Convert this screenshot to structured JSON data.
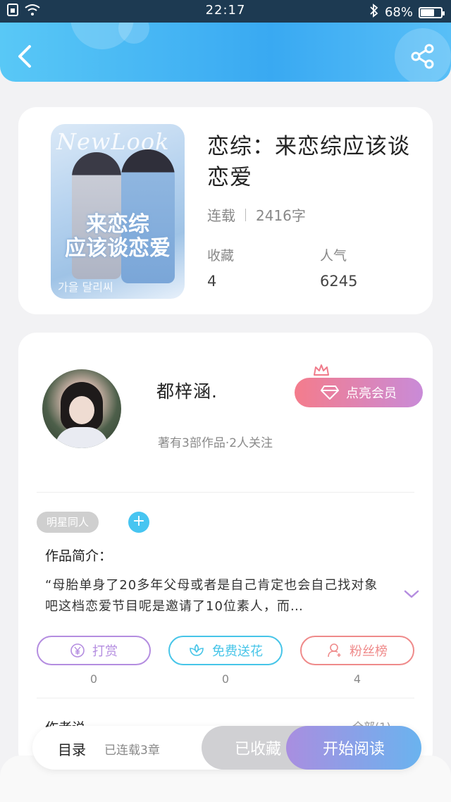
{
  "status_bar": {
    "time": "22:17",
    "battery_text": "68%",
    "battery_level": 0.68
  },
  "header": {
    "back_icon": "chevron-left-icon",
    "share_icon": "share-icon"
  },
  "book": {
    "title": "恋综：来恋综应该谈恋爱",
    "status": "连载",
    "word_count": "2416字",
    "favorites_label": "收藏",
    "favorites_value": "4",
    "popularity_label": "人气",
    "popularity_value": "6245",
    "cover": {
      "brand": "NewLook",
      "title_line1": "来恋综",
      "title_line2": "应该谈恋爱",
      "subtitle": "가을 달리씨"
    }
  },
  "author": {
    "name": "都梓涵.",
    "info": "著有3部作品·2人关注",
    "vip_button": "点亮会员"
  },
  "tags": [
    "明星同人"
  ],
  "intro": {
    "label": "作品简介：",
    "text": "“母胎单身了20多年父母或者是自己肯定也会自己找对象吧这档恋爱节目呢是邀请了10位素人，而…"
  },
  "actions": [
    {
      "label": "打赏",
      "count": "0",
      "icon": "yen-icon",
      "color": "#b48de0"
    },
    {
      "label": "免费送花",
      "count": "0",
      "icon": "flower-icon",
      "color": "#47c5e8"
    },
    {
      "label": "粉丝榜",
      "count": "4",
      "icon": "user-icon",
      "color": "#ef8a8a"
    }
  ],
  "author_says": {
    "label": "作者说",
    "link": "全部(1)"
  },
  "bottom_bar": {
    "toc": "目录",
    "toc_sub": "已连载3章",
    "collected": "已收藏",
    "start_reading": "开始阅读"
  },
  "colors": {
    "header_start": "#59c8f6",
    "header_end": "#39a9f2",
    "vip_start": "#f47c8c",
    "vip_end": "#c98bd8",
    "read_start": "#a98ee0",
    "read_end": "#6ab3ef"
  }
}
